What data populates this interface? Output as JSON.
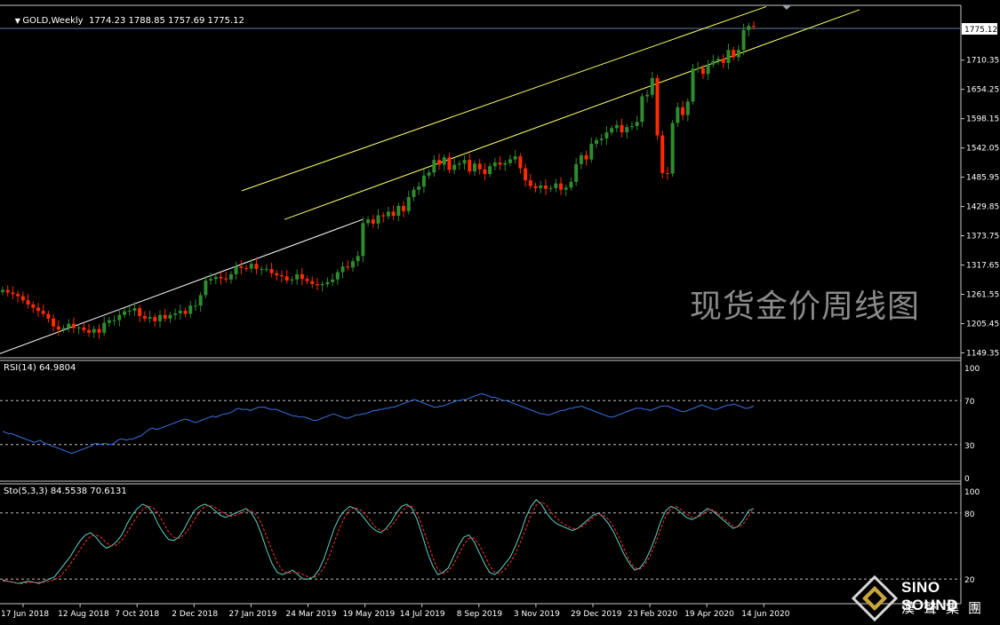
{
  "header": {
    "symbol": "GOLD,Weekly",
    "ohlc": "1774.23 1788.85 1757.69 1775.12",
    "rsi": "RSI(14) 64.9804",
    "sto": "Sto(5,3,3) 84.5538 70.6131"
  },
  "watermark": "现货金价周线图",
  "logo": {
    "name": "SINO SOUND",
    "sub": "漢聲集團"
  },
  "colors": {
    "background": "#000000",
    "bull": "#2e8b2e",
    "bear": "#ff2a00",
    "channel": "#ffff66",
    "rsi": "#3a6fe0",
    "sto_main": "#5fd3c8",
    "sto_signal": "#ff3030",
    "grid": "#c8c8c8"
  },
  "chart_data": [
    {
      "type": "candlestick",
      "title": "GOLD,Weekly",
      "price_axis_ticks": [
        "1710.35",
        "1654.25",
        "1598.15",
        "1542.05",
        "1485.95",
        "1429.85",
        "1373.75",
        "1317.65",
        "1261.55",
        "1205.45",
        "1149.35"
      ],
      "current_price": "1775.12",
      "ylim": [
        1145,
        1812
      ],
      "x_labels": [
        "17 Jun 2018",
        "12 Aug 2018",
        "7 Oct 2018",
        "2 Dec 2018",
        "27 Jan 2019",
        "24 Mar 2019",
        "19 May 2019",
        "14 Jul 2019",
        "8 Sep 2019",
        "3 Nov 2019",
        "29 Dec 2019",
        "23 Feb 2020",
        "19 Apr 2020",
        "14 Jun 2020"
      ],
      "closes": [
        1270,
        1265,
        1262,
        1258,
        1250,
        1242,
        1236,
        1230,
        1224,
        1215,
        1200,
        1194,
        1197,
        1205,
        1197,
        1198,
        1193,
        1188,
        1195,
        1188,
        1207,
        1212,
        1212,
        1222,
        1229,
        1230,
        1235,
        1220,
        1215,
        1218,
        1210,
        1222,
        1215,
        1222,
        1225,
        1230,
        1224,
        1240,
        1240,
        1260,
        1288,
        1291,
        1295,
        1292,
        1290,
        1300,
        1315,
        1312,
        1311,
        1320,
        1310,
        1310,
        1310,
        1302,
        1298,
        1296,
        1288,
        1290,
        1300,
        1291,
        1287,
        1281,
        1279,
        1281,
        1285,
        1290,
        1304,
        1315,
        1313,
        1325,
        1335,
        1398,
        1405,
        1397,
        1413,
        1411,
        1420,
        1412,
        1431,
        1421,
        1448,
        1462,
        1468,
        1489,
        1495,
        1519,
        1510,
        1524,
        1500,
        1510,
        1512,
        1519,
        1497,
        1512,
        1501,
        1492,
        1507,
        1514,
        1510,
        1513,
        1520,
        1526,
        1503,
        1480,
        1469,
        1465,
        1470,
        1464,
        1465,
        1474,
        1462,
        1466,
        1477,
        1511,
        1528,
        1520,
        1550,
        1557,
        1560,
        1572,
        1580,
        1586,
        1572,
        1582,
        1584,
        1592,
        1641,
        1644,
        1676,
        1566,
        1494,
        1493,
        1590,
        1620,
        1605,
        1631,
        1694,
        1695,
        1684,
        1702,
        1709,
        1713,
        1705,
        1730,
        1716,
        1730,
        1768,
        1776,
        1775.12
      ],
      "channel": {
        "upper": [
          [
            1460,
            1802
          ],
          [
            1813,
            1834
          ]
        ],
        "lower": [
          [
            1405,
            1254
          ],
          [
            1807,
            1625
          ]
        ],
        "support": [
          [
            1148,
            1185
          ],
          [
            1405,
            1215
          ]
        ]
      }
    },
    {
      "type": "line",
      "title": "RSI(14) 64.9804",
      "ylim": [
        0,
        100
      ],
      "levels": [
        30,
        70
      ],
      "axis_ticks": [
        "100",
        "70",
        "30",
        "0"
      ],
      "values": [
        42,
        41,
        40,
        40,
        39,
        38,
        37,
        36,
        35,
        34,
        33,
        32,
        33,
        34,
        32,
        31,
        30,
        29,
        28,
        27,
        26,
        25,
        24,
        23,
        22,
        23,
        24,
        25,
        26,
        27,
        28,
        29,
        31,
        31,
        30,
        31,
        31,
        30,
        30,
        32,
        34,
        35,
        35,
        34,
        35,
        35,
        36,
        37,
        38,
        40,
        42,
        44,
        45,
        44,
        44,
        45,
        46,
        47,
        48,
        49,
        50,
        51,
        52,
        53,
        53,
        52,
        51,
        50,
        51,
        52,
        53,
        54,
        55,
        56,
        55,
        56,
        57,
        58,
        58,
        59,
        60,
        62,
        63,
        62,
        62,
        62,
        61,
        62,
        63,
        64,
        64,
        64,
        63,
        62,
        62,
        62,
        61,
        60,
        59,
        58,
        57,
        56,
        56,
        55,
        55,
        55,
        54,
        53,
        52,
        52,
        53,
        54,
        55,
        56,
        57,
        58,
        57,
        56,
        55,
        54,
        54,
        55,
        56,
        57,
        57,
        58,
        58,
        59,
        60,
        61,
        61,
        62,
        62,
        63,
        63,
        64,
        64,
        65,
        66,
        67,
        68,
        69,
        70,
        71,
        70,
        69,
        68,
        67,
        66,
        65,
        64,
        64,
        65,
        65,
        66,
        67,
        68,
        69,
        70,
        70,
        71,
        71,
        72,
        73,
        74,
        75,
        76,
        76,
        75,
        74,
        73,
        73,
        72,
        71,
        70,
        70,
        69,
        68,
        67,
        66,
        65,
        64,
        63,
        62,
        61,
        60,
        59,
        58,
        58,
        57,
        57,
        58,
        59,
        60,
        61,
        61,
        62,
        63,
        63,
        64,
        64,
        65,
        64,
        63,
        62,
        61,
        60,
        59,
        58,
        57,
        56,
        55,
        55,
        56,
        57,
        58,
        59,
        60,
        61,
        62,
        63,
        63,
        63,
        62,
        62,
        61,
        62,
        63,
        64,
        65,
        65,
        65,
        64,
        63,
        62,
        61,
        60,
        60,
        61,
        62,
        63,
        64,
        65,
        66,
        65,
        64,
        63,
        62,
        62,
        63,
        64,
        65,
        66,
        66,
        67,
        66,
        65,
        64,
        63,
        63,
        64,
        65
      ]
    },
    {
      "type": "line",
      "title": "Sto(5,3,3) 84.5538 70.6131",
      "ylim": [
        0,
        100
      ],
      "levels": [
        20,
        80
      ],
      "axis_ticks": [
        "100",
        "80",
        "20"
      ],
      "series": [
        {
          "name": "main",
          "values": [
            19,
            18,
            17,
            16,
            17,
            18,
            17,
            16,
            18,
            20,
            22,
            28,
            34,
            40,
            48,
            55,
            60,
            62,
            58,
            52,
            48,
            50,
            54,
            60,
            70,
            78,
            84,
            88,
            86,
            80,
            70,
            62,
            56,
            55,
            58,
            65,
            74,
            82,
            86,
            88,
            86,
            82,
            78,
            76,
            78,
            80,
            82,
            84,
            80,
            72,
            60,
            46,
            34,
            26,
            24,
            26,
            28,
            24,
            20,
            20,
            22,
            28,
            38,
            52,
            66,
            76,
            82,
            86,
            84,
            80,
            74,
            68,
            64,
            62,
            66,
            72,
            80,
            86,
            88,
            84,
            74,
            60,
            44,
            32,
            24,
            26,
            30,
            40,
            50,
            58,
            60,
            54,
            44,
            34,
            26,
            24,
            28,
            34,
            40,
            50,
            62,
            76,
            86,
            92,
            88,
            80,
            74,
            70,
            68,
            66,
            64,
            66,
            70,
            74,
            78,
            80,
            76,
            70,
            62,
            52,
            42,
            34,
            28,
            30,
            36,
            46,
            58,
            72,
            82,
            86,
            84,
            80,
            76,
            74,
            76,
            80,
            84,
            82,
            78,
            74,
            70,
            66,
            68,
            74,
            82,
            84
          ]
        },
        {
          "name": "signal",
          "values": [
            18,
            18,
            17,
            16,
            16,
            17,
            17,
            17,
            17,
            18,
            19,
            22,
            27,
            33,
            40,
            47,
            54,
            59,
            60,
            58,
            53,
            50,
            51,
            55,
            62,
            70,
            77,
            83,
            86,
            85,
            80,
            71,
            63,
            58,
            57,
            60,
            66,
            74,
            81,
            86,
            87,
            85,
            82,
            79,
            77,
            78,
            80,
            82,
            82,
            78,
            70,
            58,
            46,
            35,
            28,
            25,
            26,
            26,
            24,
            22,
            21,
            24,
            30,
            40,
            53,
            66,
            76,
            83,
            85,
            83,
            79,
            73,
            67,
            64,
            64,
            68,
            74,
            81,
            86,
            86,
            80,
            68,
            54,
            40,
            29,
            25,
            27,
            33,
            42,
            51,
            57,
            57,
            51,
            42,
            32,
            26,
            25,
            29,
            35,
            43,
            54,
            66,
            78,
            87,
            90,
            87,
            80,
            75,
            71,
            68,
            66,
            66,
            68,
            72,
            76,
            79,
            78,
            74,
            67,
            58,
            47,
            37,
            30,
            29,
            33,
            41,
            52,
            65,
            77,
            84,
            86,
            83,
            79,
            76,
            76,
            78,
            82,
            83,
            80,
            76,
            72,
            68,
            67,
            70,
            77,
            84
          ]
        }
      ]
    }
  ]
}
